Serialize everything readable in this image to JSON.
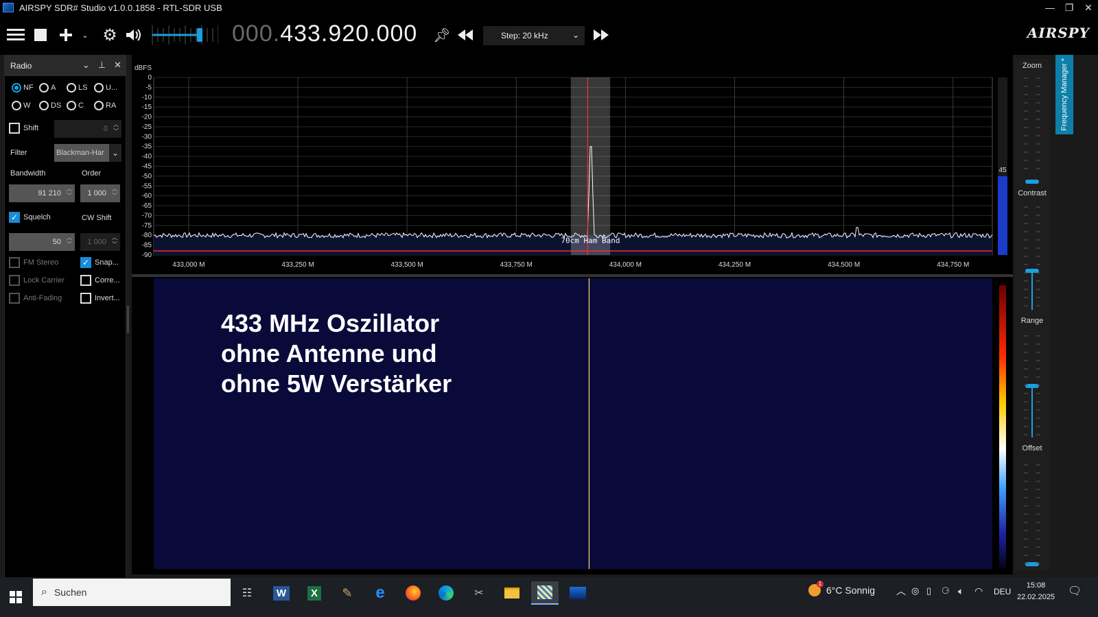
{
  "window": {
    "title": "AIRSPY SDR# Studio v1.0.0.1858 - RTL-SDR USB",
    "minimize": "—",
    "maximize": "❐",
    "close": "✕"
  },
  "toolbar": {
    "freq_dim": "000.",
    "freq_main": "433.920.000",
    "step_label": "Step: 20 kHz",
    "logo": "AIRSPY",
    "volume_level": 0.75
  },
  "radio_panel": {
    "title": "Radio",
    "modes": [
      {
        "label": "NF",
        "selected": true
      },
      {
        "label": "A",
        "selected": false
      },
      {
        "label": "LS",
        "selected": false
      },
      {
        "label": "U...",
        "selected": false
      },
      {
        "label": "W",
        "selected": false
      },
      {
        "label": "DS",
        "selected": false
      },
      {
        "label": "C",
        "selected": false
      },
      {
        "label": "RA",
        "selected": false
      }
    ],
    "shift_label": "Shift",
    "shift_value": "0",
    "filter_label": "Filter",
    "filter_value": "Blackman-Har",
    "bandwidth_label": "Bandwidth",
    "bandwidth_value": "91 210",
    "order_label": "Order",
    "order_value": "1 000",
    "squelch_label": "Squelch",
    "squelch_checked": true,
    "squelch_value": "50",
    "cwshift_label": "CW Shift",
    "cwshift_value": "1 000",
    "fm_stereo_label": "FM Stereo",
    "snap_label": "Snap...",
    "lock_carrier_label": "Lock Carrier",
    "correct_label": "Corre...",
    "anti_fading_label": "Anti-Fading",
    "invert_label": "Invert..."
  },
  "chart_data": {
    "type": "line",
    "ylabel": "dBFS",
    "yticks": [
      0,
      -5,
      -10,
      -15,
      -20,
      -25,
      -30,
      -35,
      -40,
      -45,
      -50,
      -55,
      -60,
      -65,
      -70,
      -75,
      -80,
      -85,
      -90
    ],
    "ylim": [
      -90,
      0
    ],
    "xticks": [
      "433,000 M",
      "433,250 M",
      "433,500 M",
      "433,750 M",
      "434,000 M",
      "434,250 M",
      "434,500 M",
      "434,750 M"
    ],
    "xlim_mhz": [
      432.92,
      434.84
    ],
    "noise_floor_db": -80,
    "peak": {
      "freq_mhz": 433.92,
      "db": -35
    },
    "band_label": "70cm Ham Band",
    "band_mhz": [
      433.875,
      433.965
    ],
    "tuned_freq_mhz": 433.92,
    "level_label": "45",
    "grid": true
  },
  "waterfall": {
    "overlay_lines": [
      "433 MHz Oszillator",
      "ohne Antenne und",
      "ohne 5W Verstärker"
    ]
  },
  "right_panel": {
    "zoom_label": "Zoom",
    "contrast_label": "Contrast",
    "range_label": "Range",
    "offset_label": "Offset",
    "frequency_manager_tab": "Frequency Manager *"
  },
  "taskbar": {
    "search_placeholder": "Suchen",
    "weather": "6°C  Sonnig",
    "weather_badge": "1",
    "language": "DEU",
    "time": "15:08",
    "date": "22.02.2025"
  },
  "colors": {
    "accent": "#1aa0e0",
    "trace": "#ffffff",
    "tuned_line": "#ff3030",
    "waterfall_bg": "#0a0a3a"
  }
}
